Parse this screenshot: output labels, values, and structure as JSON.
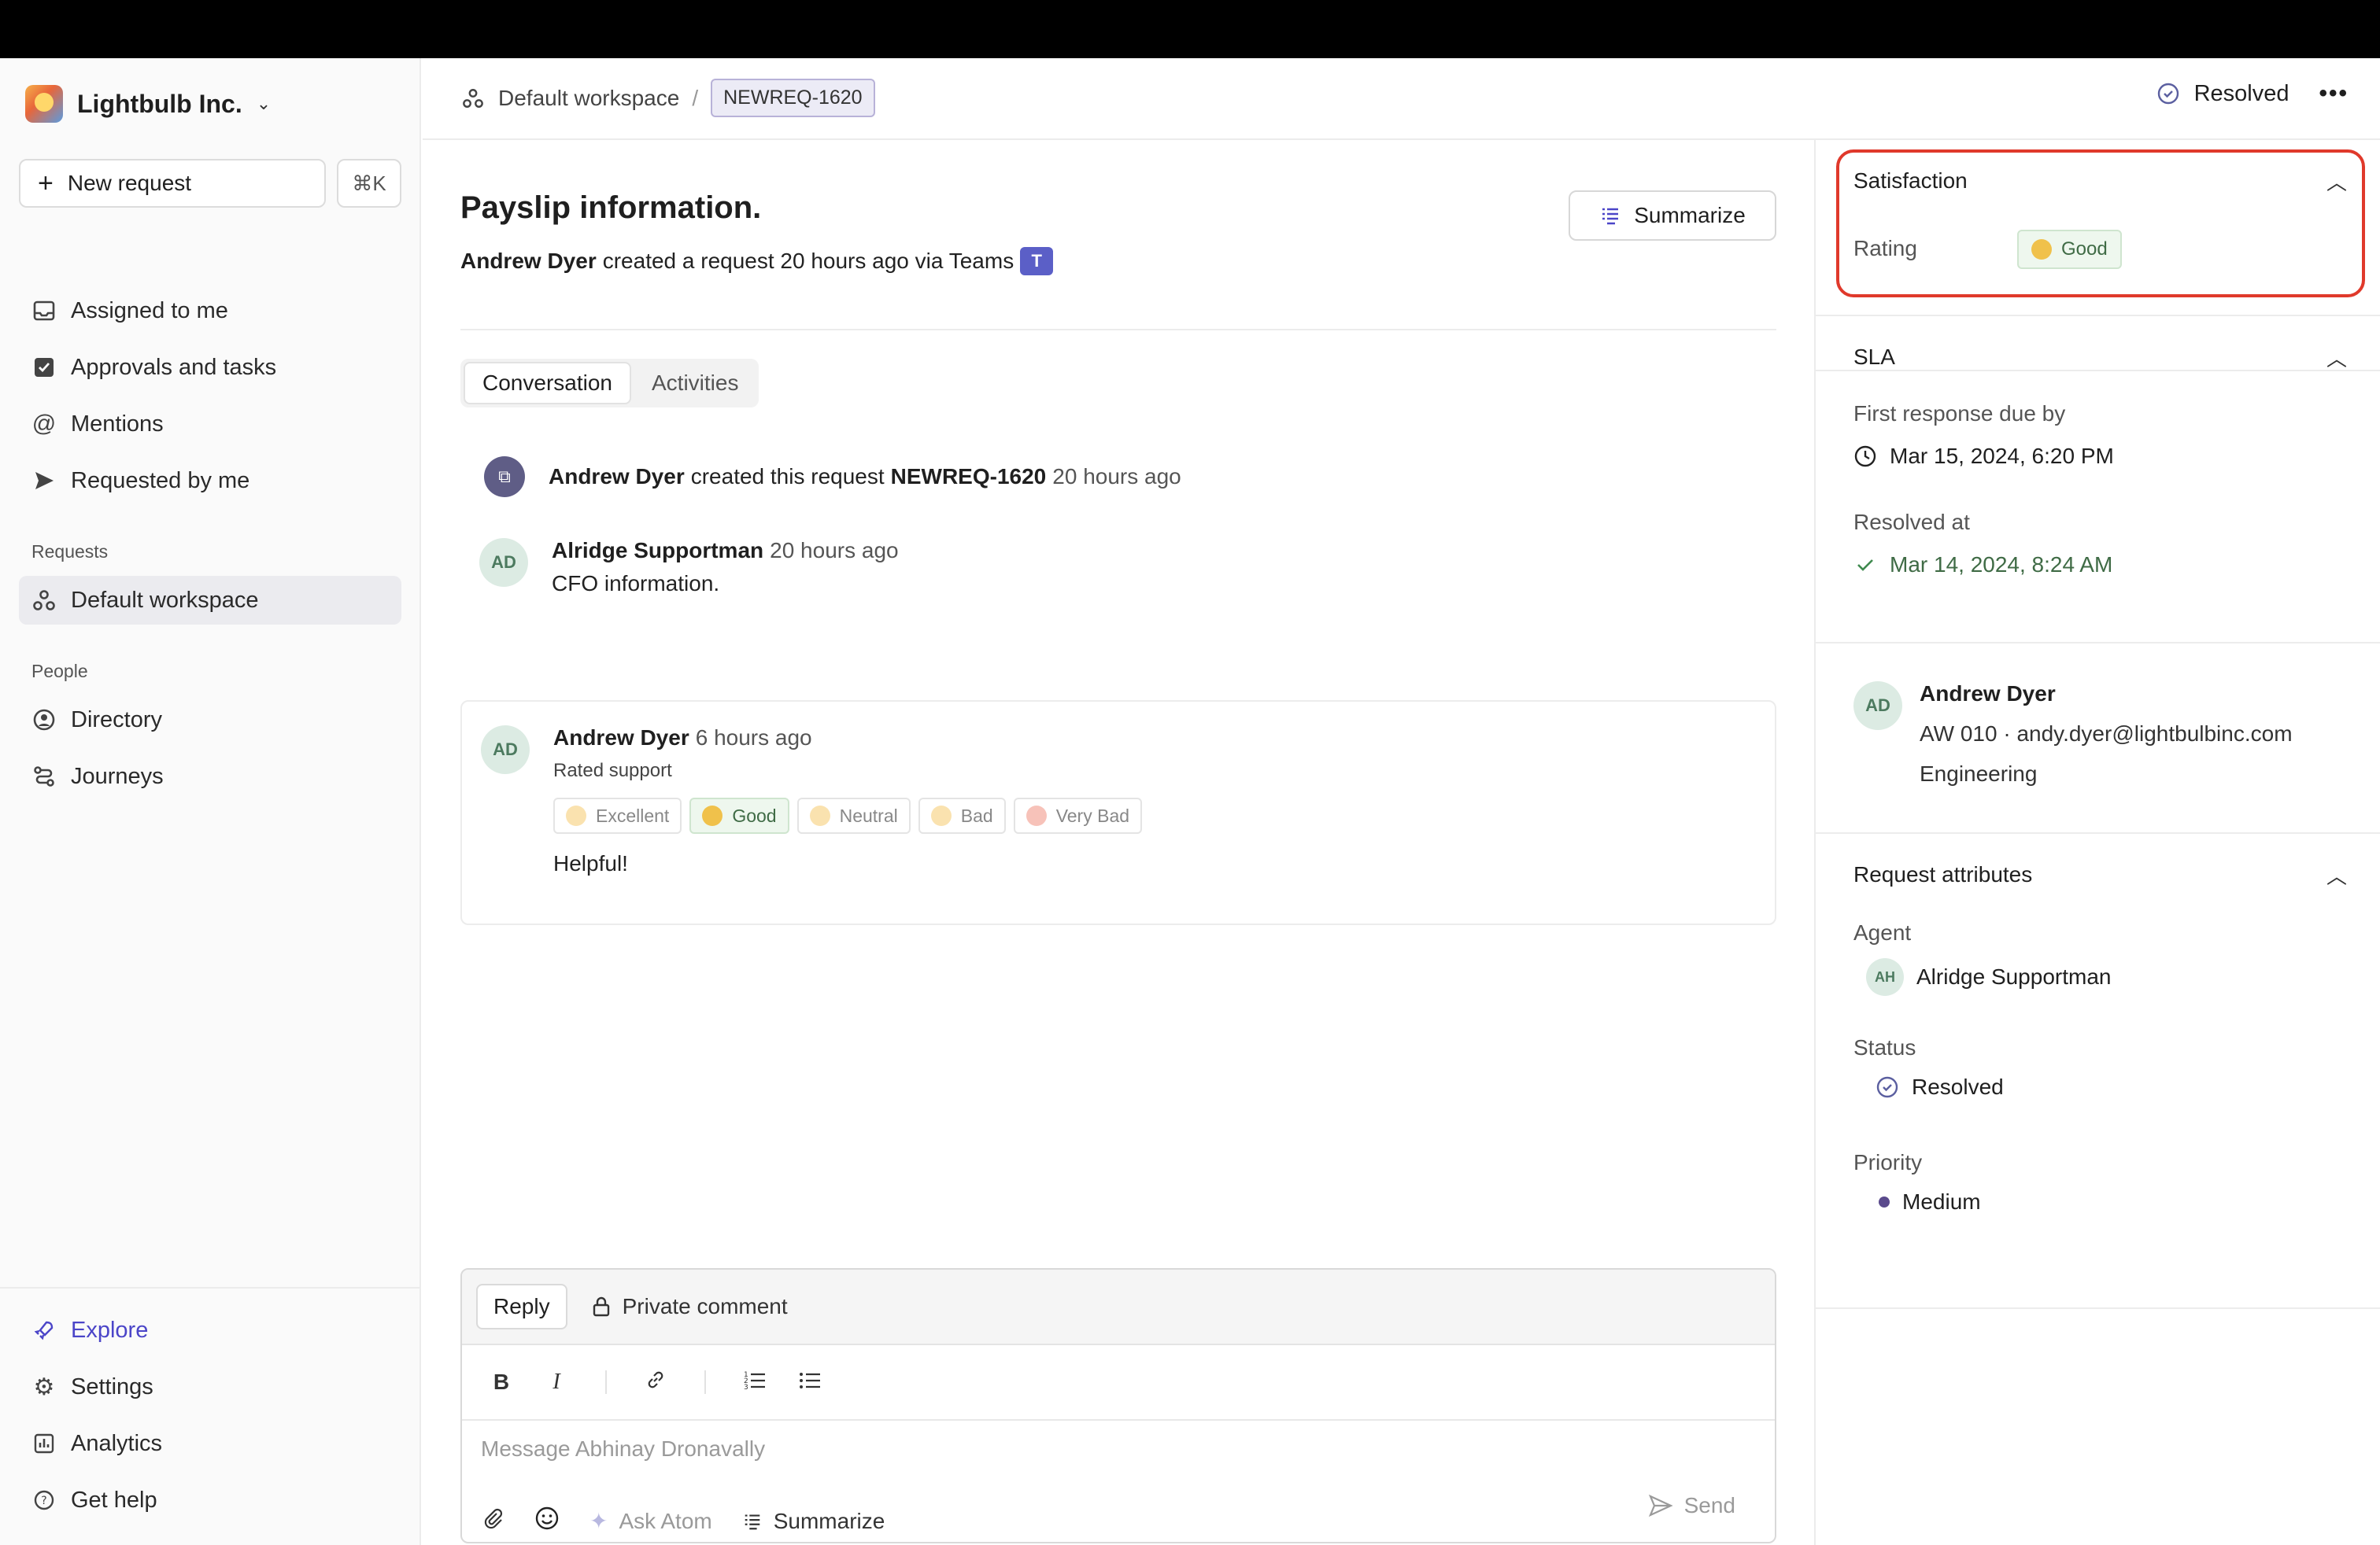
{
  "org": {
    "name": "Lightbulb Inc."
  },
  "sidebar": {
    "new_request": "New request",
    "shortcut": "⌘K",
    "items": [
      {
        "label": "Assigned to me"
      },
      {
        "label": "Approvals and tasks"
      },
      {
        "label": "Mentions"
      },
      {
        "label": "Requested by me"
      }
    ],
    "requests_section": "Requests",
    "workspace": "Default workspace",
    "people_section": "People",
    "people_items": [
      {
        "label": "Directory"
      },
      {
        "label": "Journeys"
      }
    ],
    "bottom_items": [
      {
        "label": "Explore"
      },
      {
        "label": "Settings"
      },
      {
        "label": "Analytics"
      },
      {
        "label": "Get help"
      }
    ]
  },
  "header": {
    "workspace": "Default workspace",
    "separator": "/",
    "request_id": "NEWREQ-1620",
    "status": "Resolved"
  },
  "request": {
    "title": "Payslip information.",
    "creator": "Andrew Dyer",
    "created_text": "created a request 20 hours ago via Teams",
    "summarize": "Summarize",
    "tabs": [
      "Conversation",
      "Activities"
    ]
  },
  "timeline": {
    "system_event": {
      "actor": "Andrew Dyer",
      "text": "created this request",
      "id": "NEWREQ-1620",
      "time": "20 hours ago"
    },
    "message1": {
      "initials": "AD",
      "author": "Alridge Supportman",
      "time": "20 hours ago",
      "body": "CFO information."
    },
    "rating_card": {
      "initials": "AD",
      "author": "Andrew Dyer",
      "time": "6 hours ago",
      "caption": "Rated support",
      "options": [
        "Excellent",
        "Good",
        "Neutral",
        "Bad",
        "Very Bad"
      ],
      "selected": "Good",
      "comment": "Helpful!"
    }
  },
  "composer": {
    "reply": "Reply",
    "private_comment": "Private comment",
    "placeholder": "Message Abhinay Dronavally",
    "ask_atom": "Ask Atom",
    "summarize": "Summarize",
    "send": "Send"
  },
  "panel": {
    "satisfaction": {
      "title": "Satisfaction",
      "rating_label": "Rating",
      "rating_value": "Good"
    },
    "sla": {
      "title": "SLA",
      "first_response_label": "First response due by",
      "first_response_value": "Mar 15, 2024, 6:20 PM",
      "resolved_label": "Resolved at",
      "resolved_value": "Mar 14, 2024, 8:24 AM"
    },
    "requester": {
      "initials": "AD",
      "name": "Andrew Dyer",
      "details": "AW 010 · andy.dyer@lightbulbinc.com",
      "department": "Engineering"
    },
    "attributes": {
      "title": "Request attributes",
      "agent_label": "Agent",
      "agent_initials": "AH",
      "agent_name": "Alridge Supportman",
      "status_label": "Status",
      "status_value": "Resolved",
      "priority_label": "Priority",
      "priority_value": "Medium"
    }
  },
  "colors": {
    "accent": "#4b45c8",
    "highlight": "#e0392b",
    "success": "#3f6b45"
  }
}
